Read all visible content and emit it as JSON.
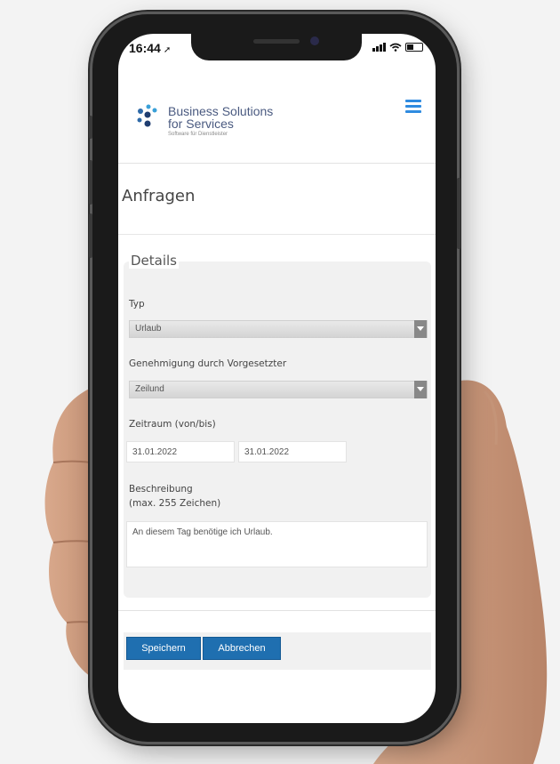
{
  "status_bar": {
    "time": "16:44",
    "location_glyph": "➚"
  },
  "header": {
    "logo_line1": "Business Solutions",
    "logo_line2": "for Services",
    "logo_tagline": "Software für Dienstleister"
  },
  "page": {
    "title": "Anfragen"
  },
  "details": {
    "legend": "Details",
    "typ_label": "Typ",
    "typ_value": "Urlaub",
    "approval_label": "Genehmigung durch Vorgesetzter",
    "approval_value": "Zeilund",
    "period_label": "Zeitraum (von/bis)",
    "date_from": "31.01.2022",
    "date_to": "31.01.2022",
    "description_label_1": "Beschreibung",
    "description_label_2": "(max. 255 Zeichen)",
    "description_value": "An diesem Tag benötige ich Urlaub."
  },
  "actions": {
    "save_label": "Speichern",
    "cancel_label": "Abbrechen"
  },
  "colors": {
    "accent": "#1f6fb0",
    "menu": "#2f8be0",
    "logo": "#3a4a70"
  }
}
